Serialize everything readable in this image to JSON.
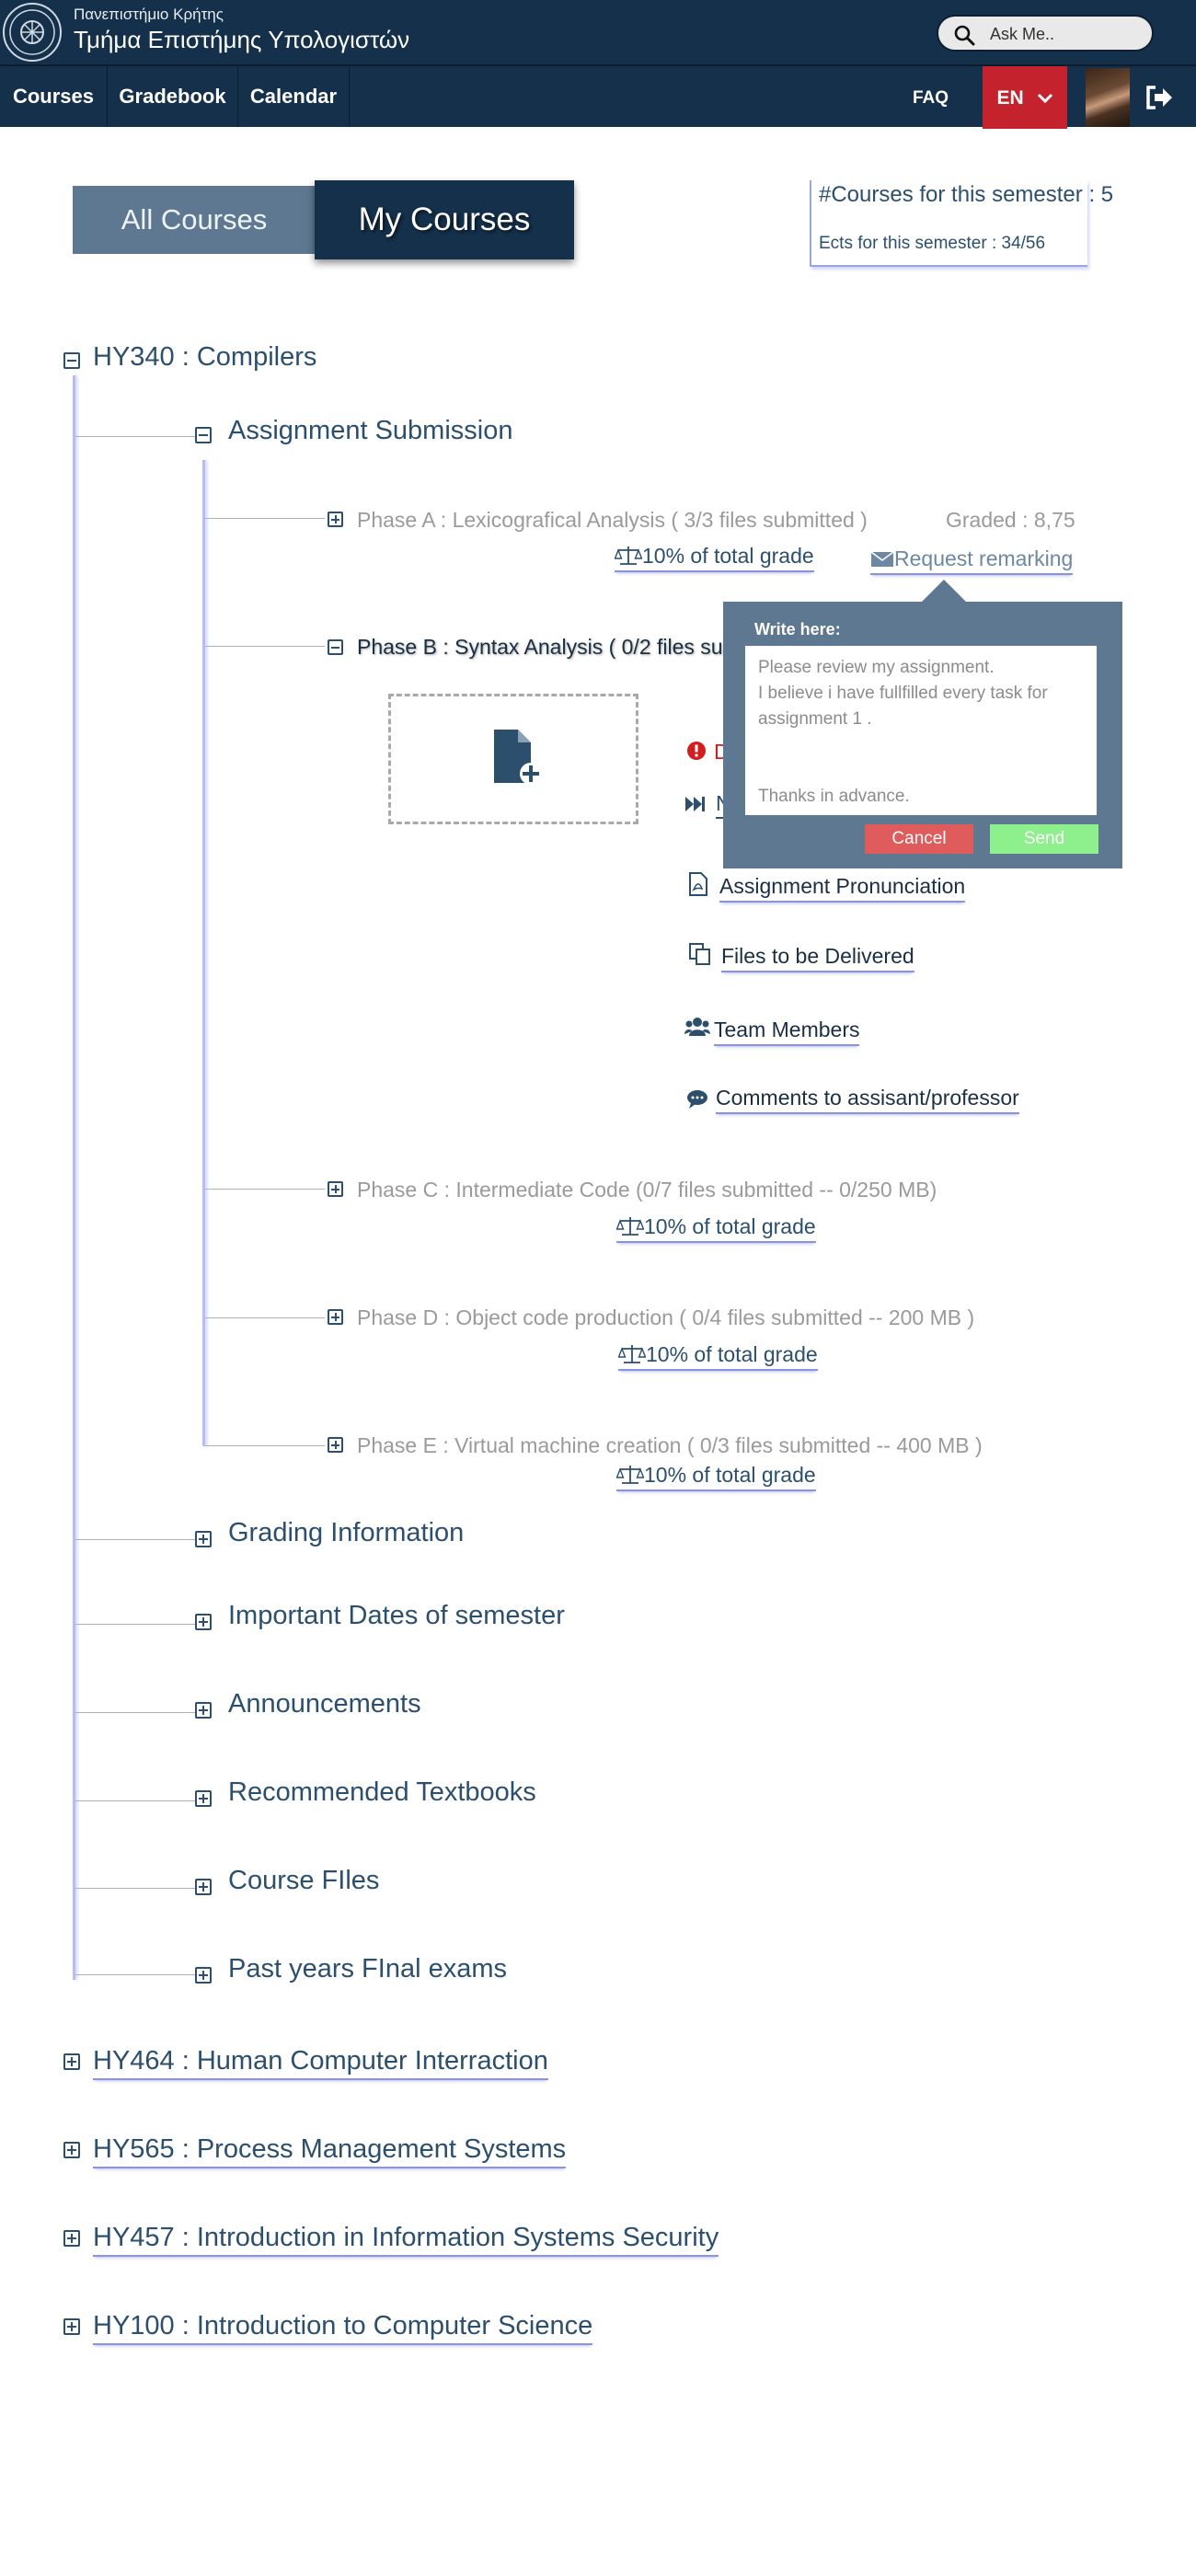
{
  "header": {
    "university": "Πανεπιστήμιο Κρήτης",
    "department": "Τμήμα Επιστήμης Υπολογιστών",
    "search_placeholder": "Ask Me.."
  },
  "nav": {
    "items": [
      "Courses",
      "Gradebook",
      "Calendar"
    ],
    "faq": "FAQ",
    "lang": "EN"
  },
  "tabs": {
    "all": "All Courses",
    "my": "My Courses"
  },
  "semester": {
    "courses_count": "#Courses for this semester : 5",
    "ects": "Ects for this semester : 34/56"
  },
  "course_main": {
    "title": "HY340 : Compilers",
    "section": "Assignment Submission",
    "phases": [
      {
        "label": "Phase A : Lexicografical Analysis ( 3/3 files submitted )",
        "weight": "10% of total grade",
        "graded": "Graded : 8,75",
        "remark": "Request remarking"
      },
      {
        "label": "Phase B : Syntax Analysis ( 0/2 files su"
      },
      {
        "label": "Phase C : Intermediate Code (0/7 files submitted -- 0/250 MB)",
        "weight": "10% of total grade"
      },
      {
        "label": "Phase D : Object code production ( 0/4 files submitted -- 200 MB )",
        "weight": "10% of total grade"
      },
      {
        "label": "Phase E : Virtual machine creation ( 0/3 files submitted -- 400 MB )",
        "weight": "10% of total grade"
      }
    ],
    "phase_b_actions": {
      "pronunciation": "Assignment Pronunciation",
      "files": "Files to be Delivered",
      "team": "Team Members",
      "comments": "Comments to assisant/professor"
    },
    "sections": [
      "Grading Information",
      "Important Dates of semester",
      "Announcements",
      "Recommended Textbooks",
      "Course FIles",
      "Past years FInal exams"
    ]
  },
  "other_courses": [
    "HY464 : Human Computer Interraction",
    "HY565 : Process Management Systems",
    "HY457 : Introduction in Information Systems Security",
    "HY100 : Introduction to Computer Science"
  ],
  "popup": {
    "label": "Write here:",
    "text": "Please review my assignment.\nI believe i have fullfilled every task for assignment 1 .\n\n\nThanks in advance.",
    "cancel": "Cancel",
    "send": "Send"
  },
  "colors": {
    "navy": "#14304a",
    "accent_red": "#c4232d",
    "tab_inactive": "#5d7890",
    "text": "#2c4f6e"
  }
}
